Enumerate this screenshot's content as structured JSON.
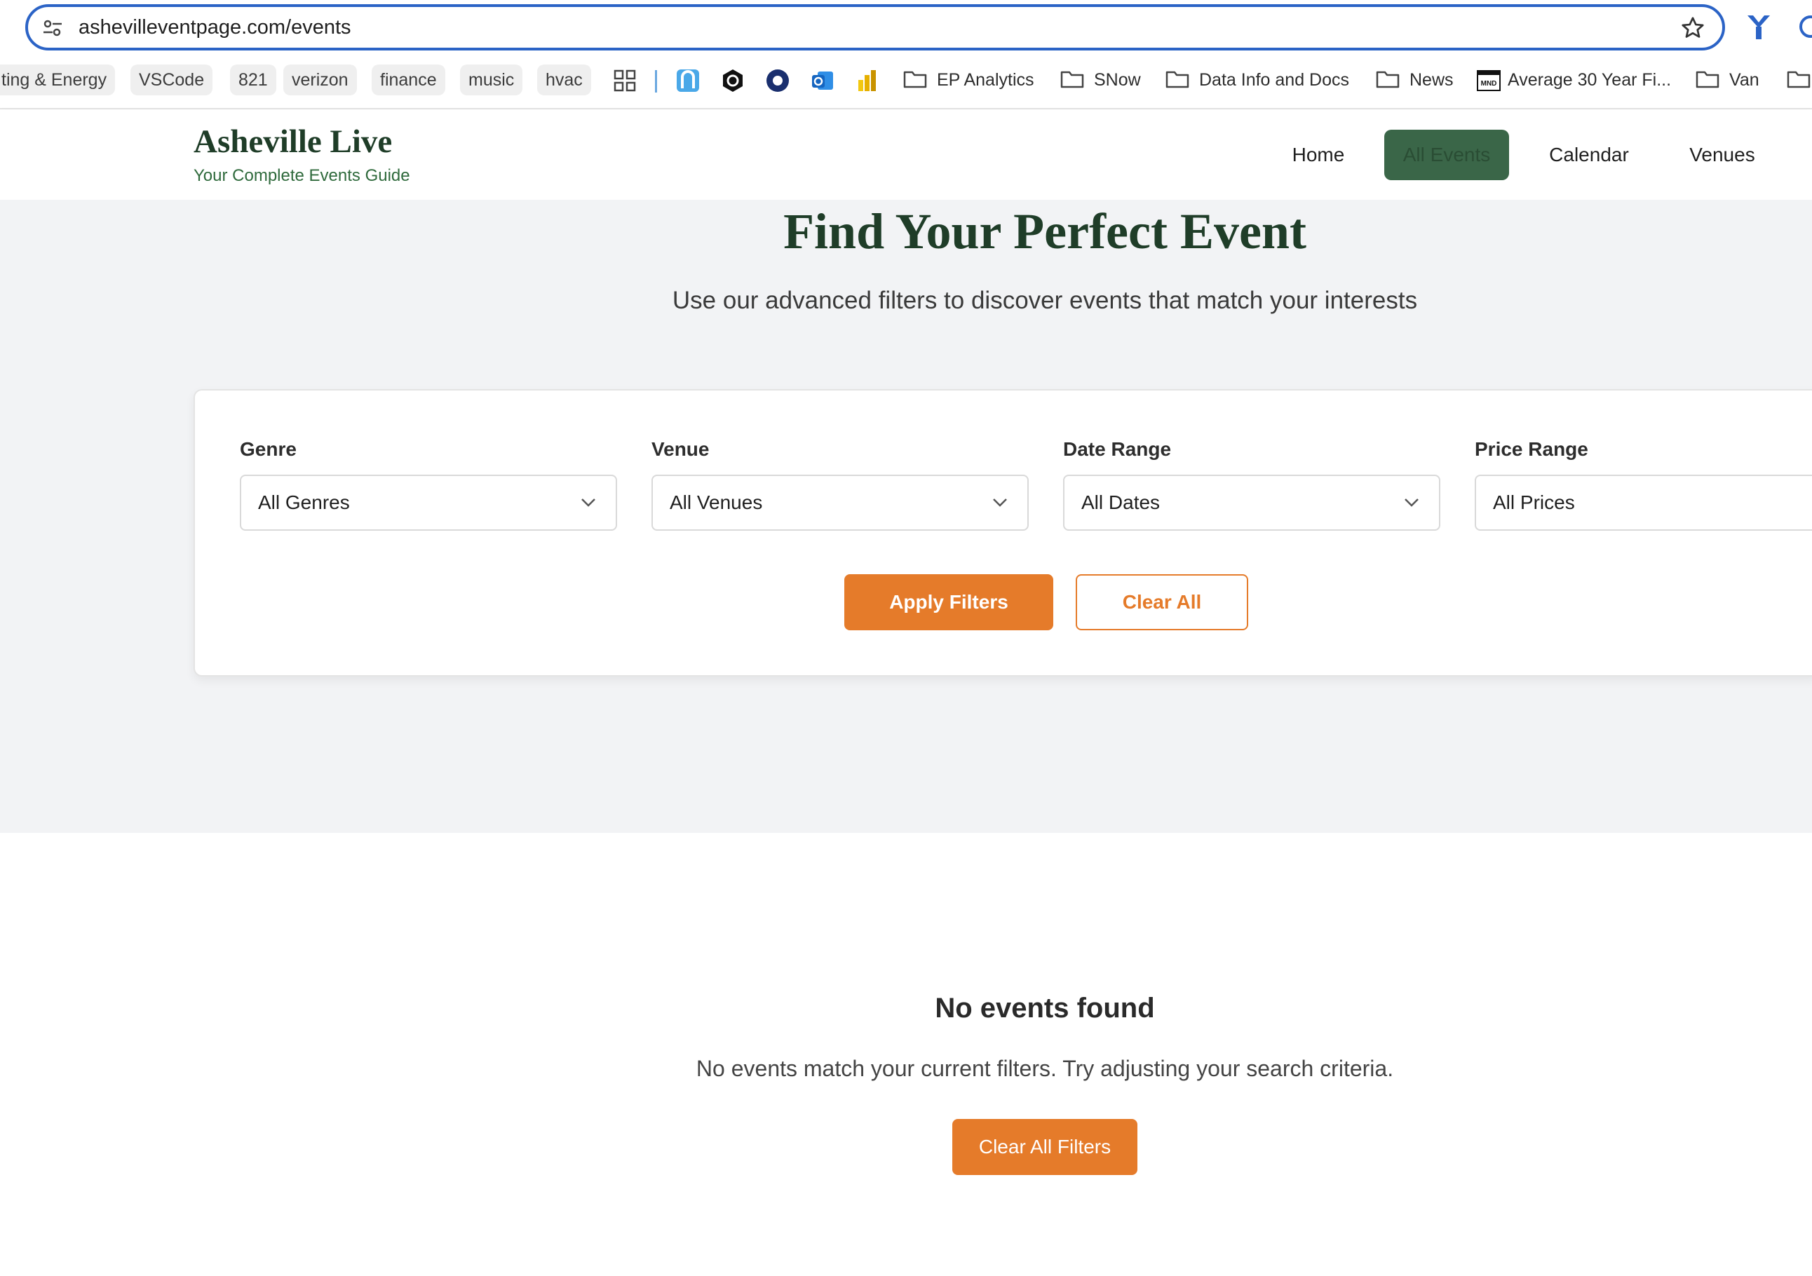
{
  "browser": {
    "url": "ashevilleventpage.com/events",
    "bookmark_chips": [
      "ting & Energy",
      "VSCode",
      "821",
      "verizon",
      "finance",
      "music",
      "hvac"
    ],
    "bookmark_folders": [
      "EP Analytics",
      "SNow",
      "Data Info and Docs",
      "News"
    ],
    "bookmark_link": "Average 30 Year Fi...",
    "bookmark_last": "Van"
  },
  "site": {
    "title": "Asheville Live",
    "tagline": "Your Complete Events Guide",
    "nav": [
      "Home",
      "All Events",
      "Calendar",
      "Venues"
    ],
    "active_nav": "All Events",
    "accent_color": "#e57b2a",
    "brand_color": "#1f3d28"
  },
  "hero": {
    "title": "Find Your Perfect Event",
    "subtitle": "Use our advanced filters to discover events that match your interests"
  },
  "filters": {
    "genre": {
      "label": "Genre",
      "value": "All Genres"
    },
    "venue": {
      "label": "Venue",
      "value": "All Venues"
    },
    "date": {
      "label": "Date Range",
      "value": "All Dates"
    },
    "price": {
      "label": "Price Range",
      "value": "All Prices"
    },
    "apply_label": "Apply Filters",
    "clear_label": "Clear All"
  },
  "results": {
    "empty_title": "No events found",
    "empty_text": "No events match your current filters. Try adjusting your search criteria.",
    "clear_button": "Clear All Filters"
  }
}
